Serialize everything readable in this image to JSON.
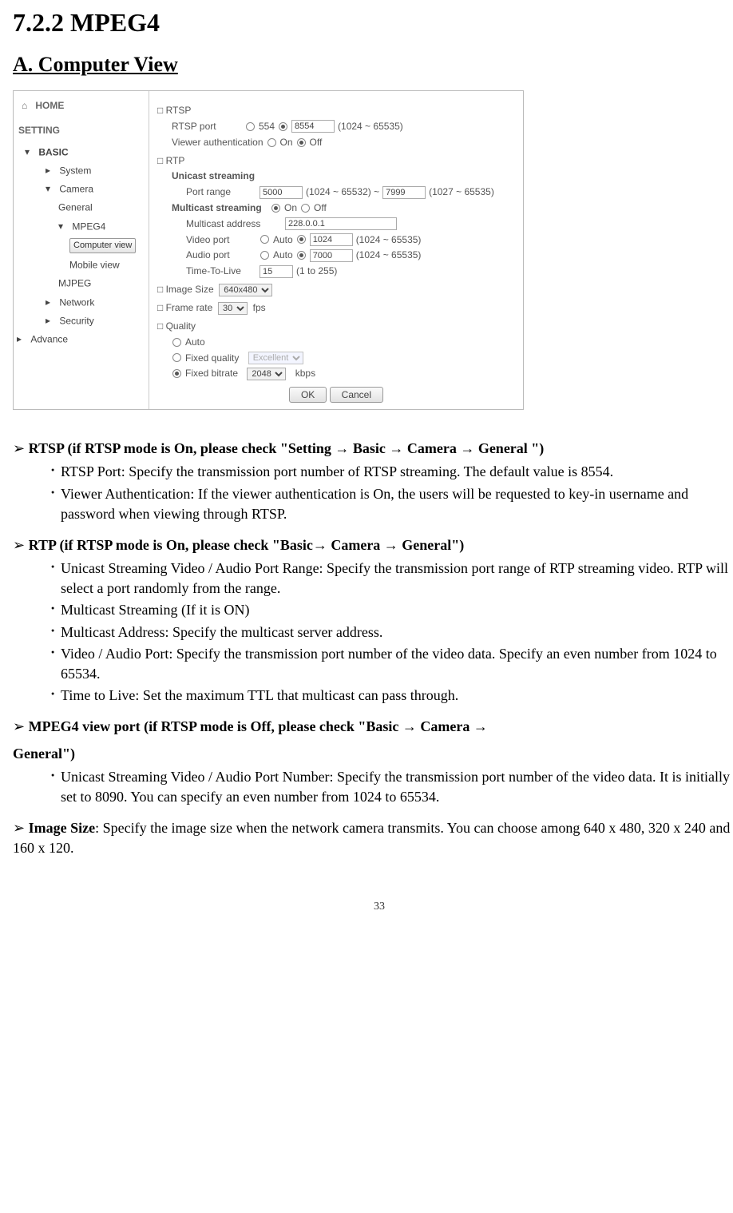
{
  "title_main": "7.2.2 MPEG4",
  "title_sub": "A. Computer View",
  "nav": {
    "home": "HOME",
    "setting": "SETTING",
    "basic": "BASIC",
    "system": "System",
    "camera": "Camera",
    "general": "General",
    "mpeg4": "MPEG4",
    "computer_view": "Computer view",
    "mobile_view": "Mobile view",
    "mjpeg": "MJPEG",
    "network": "Network",
    "security": "Security",
    "advance": "Advance"
  },
  "panel": {
    "rtsp": {
      "header": "RTSP",
      "rtsp_port_label": "RTSP port",
      "rtsp_port_option_554": "554",
      "rtsp_port_value": "8554",
      "rtsp_port_hint": "(1024 ~ 65535)",
      "viewer_auth_label": "Viewer authentication",
      "on": "On",
      "off": "Off"
    },
    "rtp": {
      "header": "RTP",
      "unicast": "Unicast streaming",
      "port_range_label": "Port range",
      "port_range_from": "5000",
      "port_range_from_hint": "(1024 ~ 65532) ~",
      "port_range_to": "7999",
      "port_range_to_hint": "(1027 ~ 65535)",
      "multicast_label": "Multicast streaming",
      "on": "On",
      "off": "Off",
      "multicast_addr_label": "Multicast address",
      "multicast_addr_value": "228.0.0.1",
      "video_port_label": "Video port",
      "auto": "Auto",
      "video_port_value": "1024",
      "video_port_hint": "(1024 ~ 65535)",
      "audio_port_label": "Audio port",
      "audio_port_value": "7000",
      "audio_port_hint": "(1024 ~ 65535)",
      "ttl_label": "Time-To-Live",
      "ttl_value": "15",
      "ttl_hint": "(1 to 255)"
    },
    "image_size": {
      "header": "Image Size",
      "value": "640x480"
    },
    "frame_rate": {
      "header": "Frame rate",
      "value": "30",
      "suffix": "fps"
    },
    "quality": {
      "header": "Quality",
      "auto": "Auto",
      "fixed_quality": "Fixed quality",
      "fixed_quality_value": "Excellent",
      "fixed_bitrate": "Fixed bitrate",
      "fixed_bitrate_value": "2048",
      "fixed_bitrate_suffix": "kbps"
    },
    "ok": "OK",
    "cancel": "Cancel"
  },
  "body": {
    "sec1_head": "RTSP (if RTSP mode is On, please check \"Setting → Basic → Camera → General \")",
    "sec1_b1": "RTSP Port: Specify the transmission port number of RTSP streaming. The default value is 8554.",
    "sec1_b2": "Viewer Authentication: If the viewer authentication is On, the users will be requested to key-in username and password when viewing through RTSP.",
    "sec2_head": "RTP (if RTSP mode is On, please check \"Basic→ Camera → General\")",
    "sec2_b1": "Unicast Streaming Video / Audio Port Range: Specify the transmission port range of RTP streaming video. RTP will select a port randomly from the range.",
    "sec2_b2": "Multicast Streaming (If it is ON)",
    "sec2_b3": "Multicast Address: Specify the multicast server address.",
    "sec2_b4": "Video / Audio Port: Specify the transmission port number of the video data. Specify an even number from 1024 to 65534.",
    "sec2_b5": "Time to Live: Set the maximum TTL that multicast can pass through.",
    "sec3_head_a": "MPEG4 view port (if RTSP mode is Off, please check \"Basic → Camera →",
    "sec3_head_b": "General\")",
    "sec3_b1": "Unicast Streaming Video / Audio Port Number: Specify the transmission port number of the video data. It is initially set to 8090. You can specify an even number from 1024 to 65534.",
    "sec4_head": "Image Size",
    "sec4_body": ": Specify the image size when the network camera transmits. You can choose among 640 x 480, 320 x 240 and 160 x 120.",
    "page_num": "33"
  }
}
